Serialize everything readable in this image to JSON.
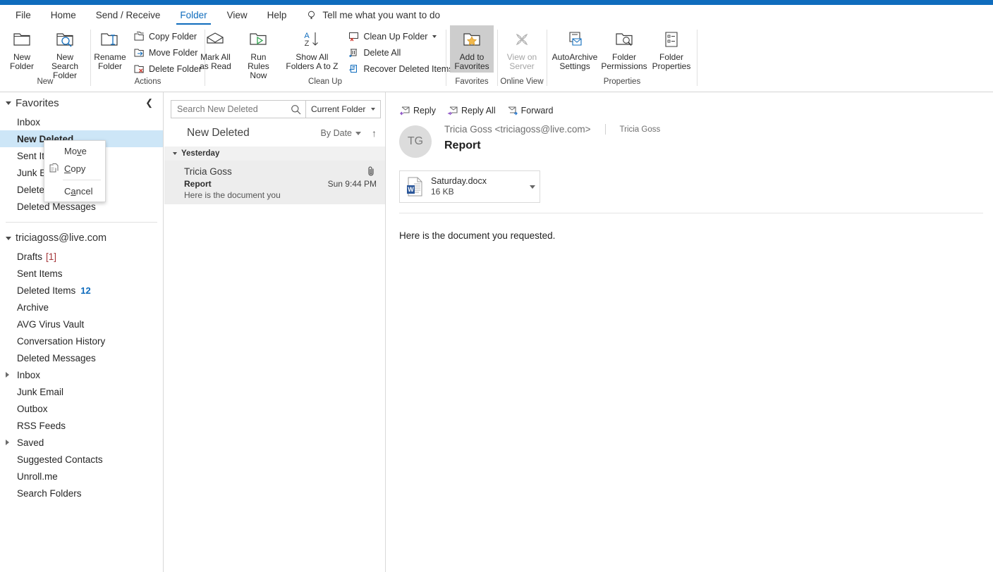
{
  "ribbon": {
    "tabs": [
      {
        "label": "File",
        "active": false
      },
      {
        "label": "Home",
        "active": false
      },
      {
        "label": "Send / Receive",
        "active": false
      },
      {
        "label": "Folder",
        "active": true
      },
      {
        "label": "View",
        "active": false
      },
      {
        "label": "Help",
        "active": false
      }
    ],
    "tellme": "Tell me what you want to do",
    "groups": [
      {
        "label": "New",
        "buttons": [
          {
            "label": "New\nFolder",
            "icon": "new-folder-icon"
          },
          {
            "label": "New Search\nFolder",
            "icon": "new-search-folder-icon"
          }
        ]
      },
      {
        "label": "Actions",
        "buttons": [
          {
            "label": "Rename\nFolder",
            "icon": "rename-folder-icon"
          }
        ],
        "small_buttons": [
          {
            "label": "Copy Folder",
            "icon": "copy-folder-icon"
          },
          {
            "label": "Move Folder",
            "icon": "move-folder-icon"
          },
          {
            "label": "Delete Folder",
            "icon": "delete-folder-icon"
          }
        ]
      },
      {
        "label": "Clean Up",
        "buttons": [
          {
            "label": "Mark All\nas Read",
            "icon": "mark-all-read-icon"
          },
          {
            "label": "Run Rules\nNow",
            "icon": "run-rules-icon"
          },
          {
            "label": "Show All\nFolders A to Z",
            "icon": "sort-az-icon"
          }
        ],
        "small_buttons": [
          {
            "label": "Clean Up Folder",
            "icon": "clean-up-folder-icon",
            "has_caret": true
          },
          {
            "label": "Delete All",
            "icon": "delete-all-icon"
          },
          {
            "label": "Recover Deleted Items",
            "icon": "recover-deleted-icon"
          }
        ]
      },
      {
        "label": "Favorites",
        "buttons": [
          {
            "label": "Add to\nFavorites",
            "icon": "add-to-favorites-icon",
            "selected": true
          }
        ]
      },
      {
        "label": "Online View",
        "buttons": [
          {
            "label": "View on\nServer",
            "icon": "view-on-server-icon",
            "disabled": true
          }
        ]
      },
      {
        "label": "Properties",
        "buttons": [
          {
            "label": "AutoArchive\nSettings",
            "icon": "autoarchive-icon"
          },
          {
            "label": "Folder\nPermissions",
            "icon": "folder-permissions-icon"
          },
          {
            "label": "Folder\nProperties",
            "icon": "folder-properties-icon"
          }
        ]
      }
    ]
  },
  "sidebar": {
    "favorites_header": "Favorites",
    "favorites": [
      {
        "label": "Inbox"
      },
      {
        "label": "New Deleted",
        "selected": true
      },
      {
        "label": "Sent Items"
      },
      {
        "label": "Junk Email"
      },
      {
        "label": "Deleted Items"
      },
      {
        "label": "Deleted Messages"
      }
    ],
    "account": "triciagoss@live.com",
    "folders": [
      {
        "label": "Drafts",
        "count_red": "[1]",
        "expandable": false
      },
      {
        "label": "Sent Items",
        "expandable": false
      },
      {
        "label": "Deleted Items",
        "count_blue": "12",
        "expandable": false
      },
      {
        "label": "Archive",
        "expandable": false
      },
      {
        "label": "AVG Virus Vault",
        "expandable": false
      },
      {
        "label": "Conversation History",
        "expandable": false
      },
      {
        "label": "Deleted Messages",
        "expandable": false
      },
      {
        "label": "Inbox",
        "expandable": true
      },
      {
        "label": "Junk Email",
        "expandable": false
      },
      {
        "label": "Outbox",
        "expandable": false
      },
      {
        "label": "RSS Feeds",
        "expandable": false
      },
      {
        "label": "Saved",
        "expandable": true
      },
      {
        "label": "Suggested Contacts",
        "expandable": false
      },
      {
        "label": "Unroll.me",
        "expandable": false
      },
      {
        "label": "Search Folders",
        "expandable": false
      }
    ]
  },
  "context_menu": {
    "items": [
      {
        "prefix": "Mo",
        "underline": "v",
        "suffix": "e",
        "icon": null
      },
      {
        "prefix": "",
        "underline": "C",
        "suffix": "opy",
        "icon": "copy-icon"
      },
      {
        "prefix": "C",
        "underline": "a",
        "suffix": "ncel",
        "icon": null
      }
    ]
  },
  "list": {
    "search_placeholder": "Search New Deleted",
    "search_value": "",
    "scope": "Current Folder",
    "title": "New Deleted",
    "sort": "By Date",
    "group": "Yesterday",
    "messages": [
      {
        "from": "Tricia Goss",
        "subject": "Report",
        "preview": "Here is the document you",
        "time": "Sun 9:44 PM",
        "has_attachment": true
      }
    ]
  },
  "reader": {
    "actions": [
      {
        "label": "Reply",
        "icon": "reply-icon"
      },
      {
        "label": "Reply All",
        "icon": "reply-all-icon"
      },
      {
        "label": "Forward",
        "icon": "forward-icon"
      }
    ],
    "avatar_initials": "TG",
    "sender": "Tricia Goss <triciagoss@live.com>",
    "recipient": "Tricia Goss",
    "subject": "Report",
    "attachment": {
      "name": "Saturday.docx",
      "size": "16 KB",
      "icon": "word-doc-icon"
    },
    "body": "Here is the document you requested."
  },
  "colors": {
    "accent": "#0f6cbd",
    "selection": "#cde6f7",
    "list_selection": "#ededed",
    "group_header": "#f1f1f1"
  }
}
